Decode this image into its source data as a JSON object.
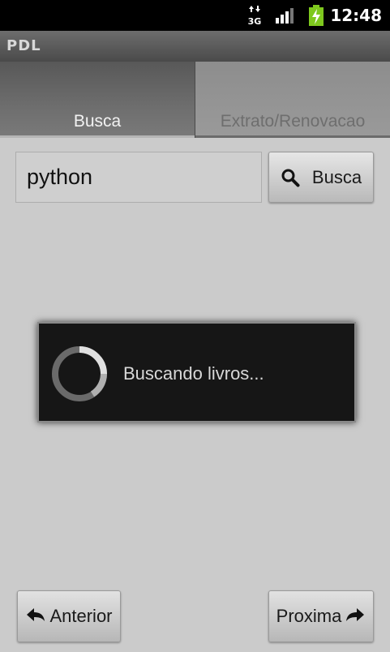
{
  "status_bar": {
    "network_label": "3G",
    "time": "12:48",
    "icons": [
      "data-arrows-icon",
      "signal-icon",
      "battery-charging-icon"
    ]
  },
  "app": {
    "title": "PDL"
  },
  "tabs": [
    {
      "label": "Busca",
      "active": true
    },
    {
      "label": "Extrato/Renovacao",
      "active": false
    }
  ],
  "search": {
    "value": "python",
    "button_label": "Busca",
    "button_icon": "search-icon"
  },
  "progress_dialog": {
    "message": "Buscando livros..."
  },
  "navigation": {
    "prev_label": "Anterior",
    "prev_icon": "arrow-left-icon",
    "next_label": "Proxima",
    "next_icon": "arrow-right-icon"
  },
  "colors": {
    "background": "#cbcbcb",
    "title_bar": "#5a5a5a",
    "dialog_background": "#161616",
    "battery_green": "#7ec81e"
  }
}
